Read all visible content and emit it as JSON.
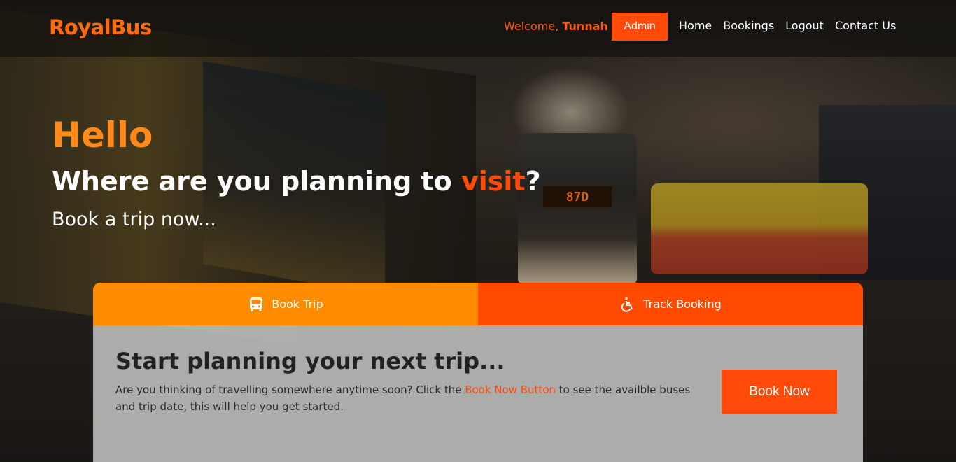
{
  "navbar": {
    "logo": "RoyalBus",
    "welcome_prefix": "Welcome,",
    "username": "Tunnah",
    "admin_label": "Admin",
    "links": [
      "Home",
      "Bookings",
      "Logout",
      "Contact Us"
    ]
  },
  "hero": {
    "hello": "Hello",
    "question_start": "Where are you planning to ",
    "question_accent": "visit",
    "question_end": "?",
    "subline": "Book a trip now...",
    "bus_sign": "87D"
  },
  "booking": {
    "tabs": [
      {
        "label": "Book Trip",
        "icon": "bus-icon"
      },
      {
        "label": "Track Booking",
        "icon": "wheelchair-icon"
      }
    ],
    "title": "Start planning your next trip...",
    "desc_start": "Are you thinking of travelling somewhere anytime soon? Click the ",
    "desc_link": "Book Now Button",
    "desc_end": " to see the availble buses and trip date, this will help you get started.",
    "cta": "Book Now"
  },
  "colors": {
    "brand_orange": "#ff6a10",
    "accent_red_orange": "#ff4a0a",
    "tab_orange": "#ff8c00"
  }
}
